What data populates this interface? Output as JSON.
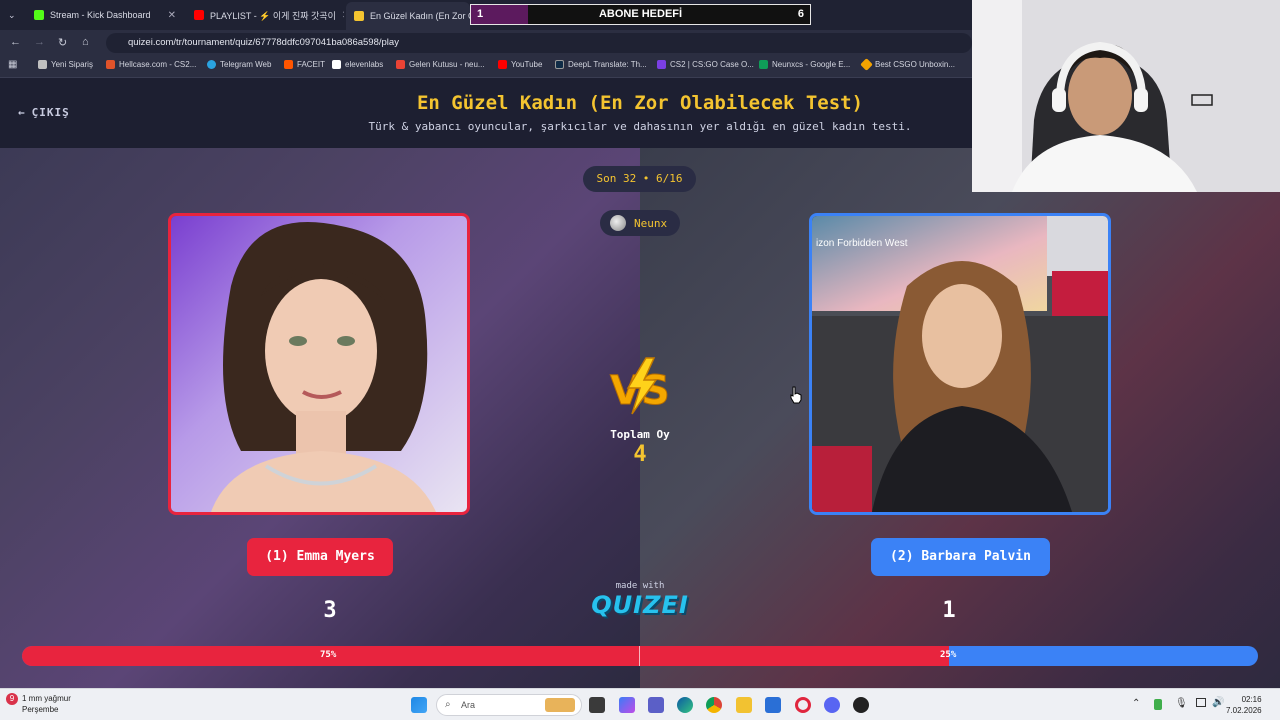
{
  "browser": {
    "tabs": [
      {
        "label": "Stream - Kick Dashboard",
        "color": "#53fc18"
      },
      {
        "label": "PLAYLIST - ⚡ 이게 진짜 갓곡이",
        "color": "#ff0000"
      },
      {
        "label": "En Güzel Kadın (En Zor Olabil",
        "color": "#f4c430"
      }
    ],
    "url": "quizei.com/tr/tournament/quiz/67778ddfc097041ba086a598/play",
    "bookmarks": [
      {
        "label": "Yeni Sipariş",
        "color": "#c0c0c0"
      },
      {
        "label": "Hellcase.com - CS2...",
        "color": "#e0532a"
      },
      {
        "label": "Telegram Web",
        "color": "#2aa3e0"
      },
      {
        "label": "FACEIT",
        "color": "#ff5500"
      },
      {
        "label": "elevenlabs",
        "color": "#ffffff"
      },
      {
        "label": "Gelen Kutusu - neu...",
        "color": "#ea4335"
      },
      {
        "label": "YouTube",
        "color": "#ff0000"
      },
      {
        "label": "DeepL Translate: Th...",
        "color": "#0f2b46"
      },
      {
        "label": "CS2 | CS:GO Case O...",
        "color": "#7b3fe4"
      },
      {
        "label": "Neunxcs - Google E...",
        "color": "#0f9d58"
      },
      {
        "label": "Best CSGO Unboxin...",
        "color": "#f4a300"
      }
    ]
  },
  "overlay": {
    "goal_current": "1",
    "goal_label": "ABONE HEDEFİ",
    "goal_target": "6",
    "goal_progress": 0.167
  },
  "quiz": {
    "back_label": "ÇIKIŞ",
    "title": "En Güzel Kadın (En Zor Olabilecek Test)",
    "subtitle": "Türk & yabancı oyuncular, şarkıcılar ve dahasının yer aldığı en güzel kadın testi.",
    "round": "Son 32 • 6/16",
    "host": "Neunx",
    "total_label": "Toplam Oy",
    "total_value": "4",
    "left": {
      "name": "(1) Emma Myers",
      "votes": "3",
      "percent_label": "75%",
      "percent": 75
    },
    "right": {
      "name": "(2) Barbara Palvin",
      "votes": "1",
      "percent_label": "25%",
      "percent": 25
    },
    "right_photo_text": "izon Forbidden West",
    "made_with": "made with",
    "brand": "QUIZEI"
  },
  "taskbar": {
    "weather_temp": "9",
    "weather_text": "1 mm yağmur",
    "weather_day": "Perşembe",
    "search_placeholder": "Ara",
    "time": "02:16",
    "date": "7.02.2026"
  }
}
